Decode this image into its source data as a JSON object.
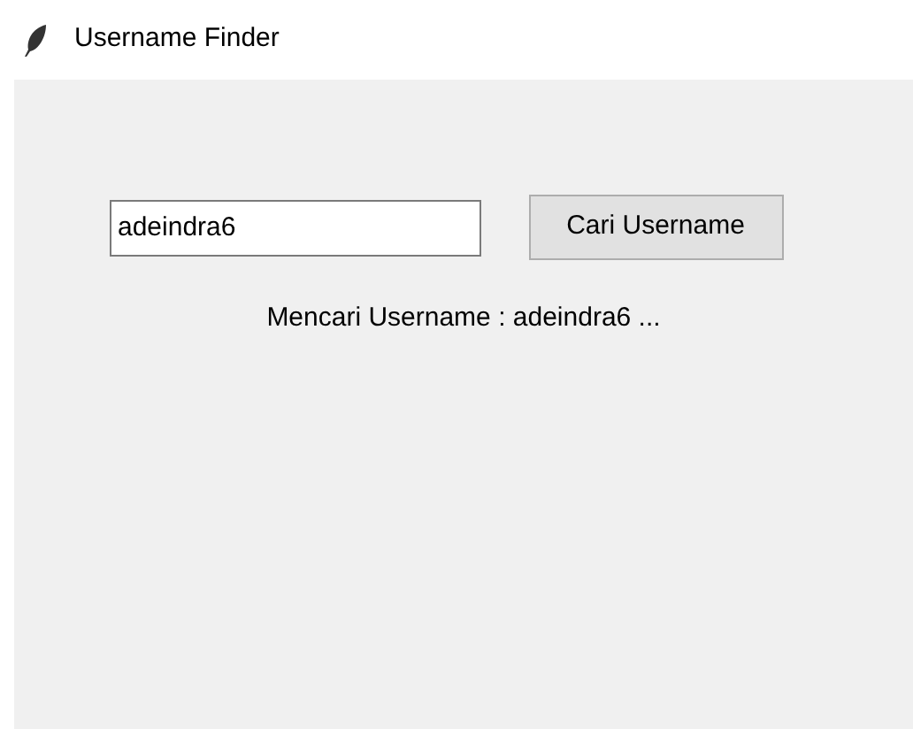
{
  "window": {
    "title": "Username Finder"
  },
  "search": {
    "value": "adeindra6"
  },
  "button": {
    "label": "Cari Username"
  },
  "status": "Mencari Username : adeindra6 ..."
}
